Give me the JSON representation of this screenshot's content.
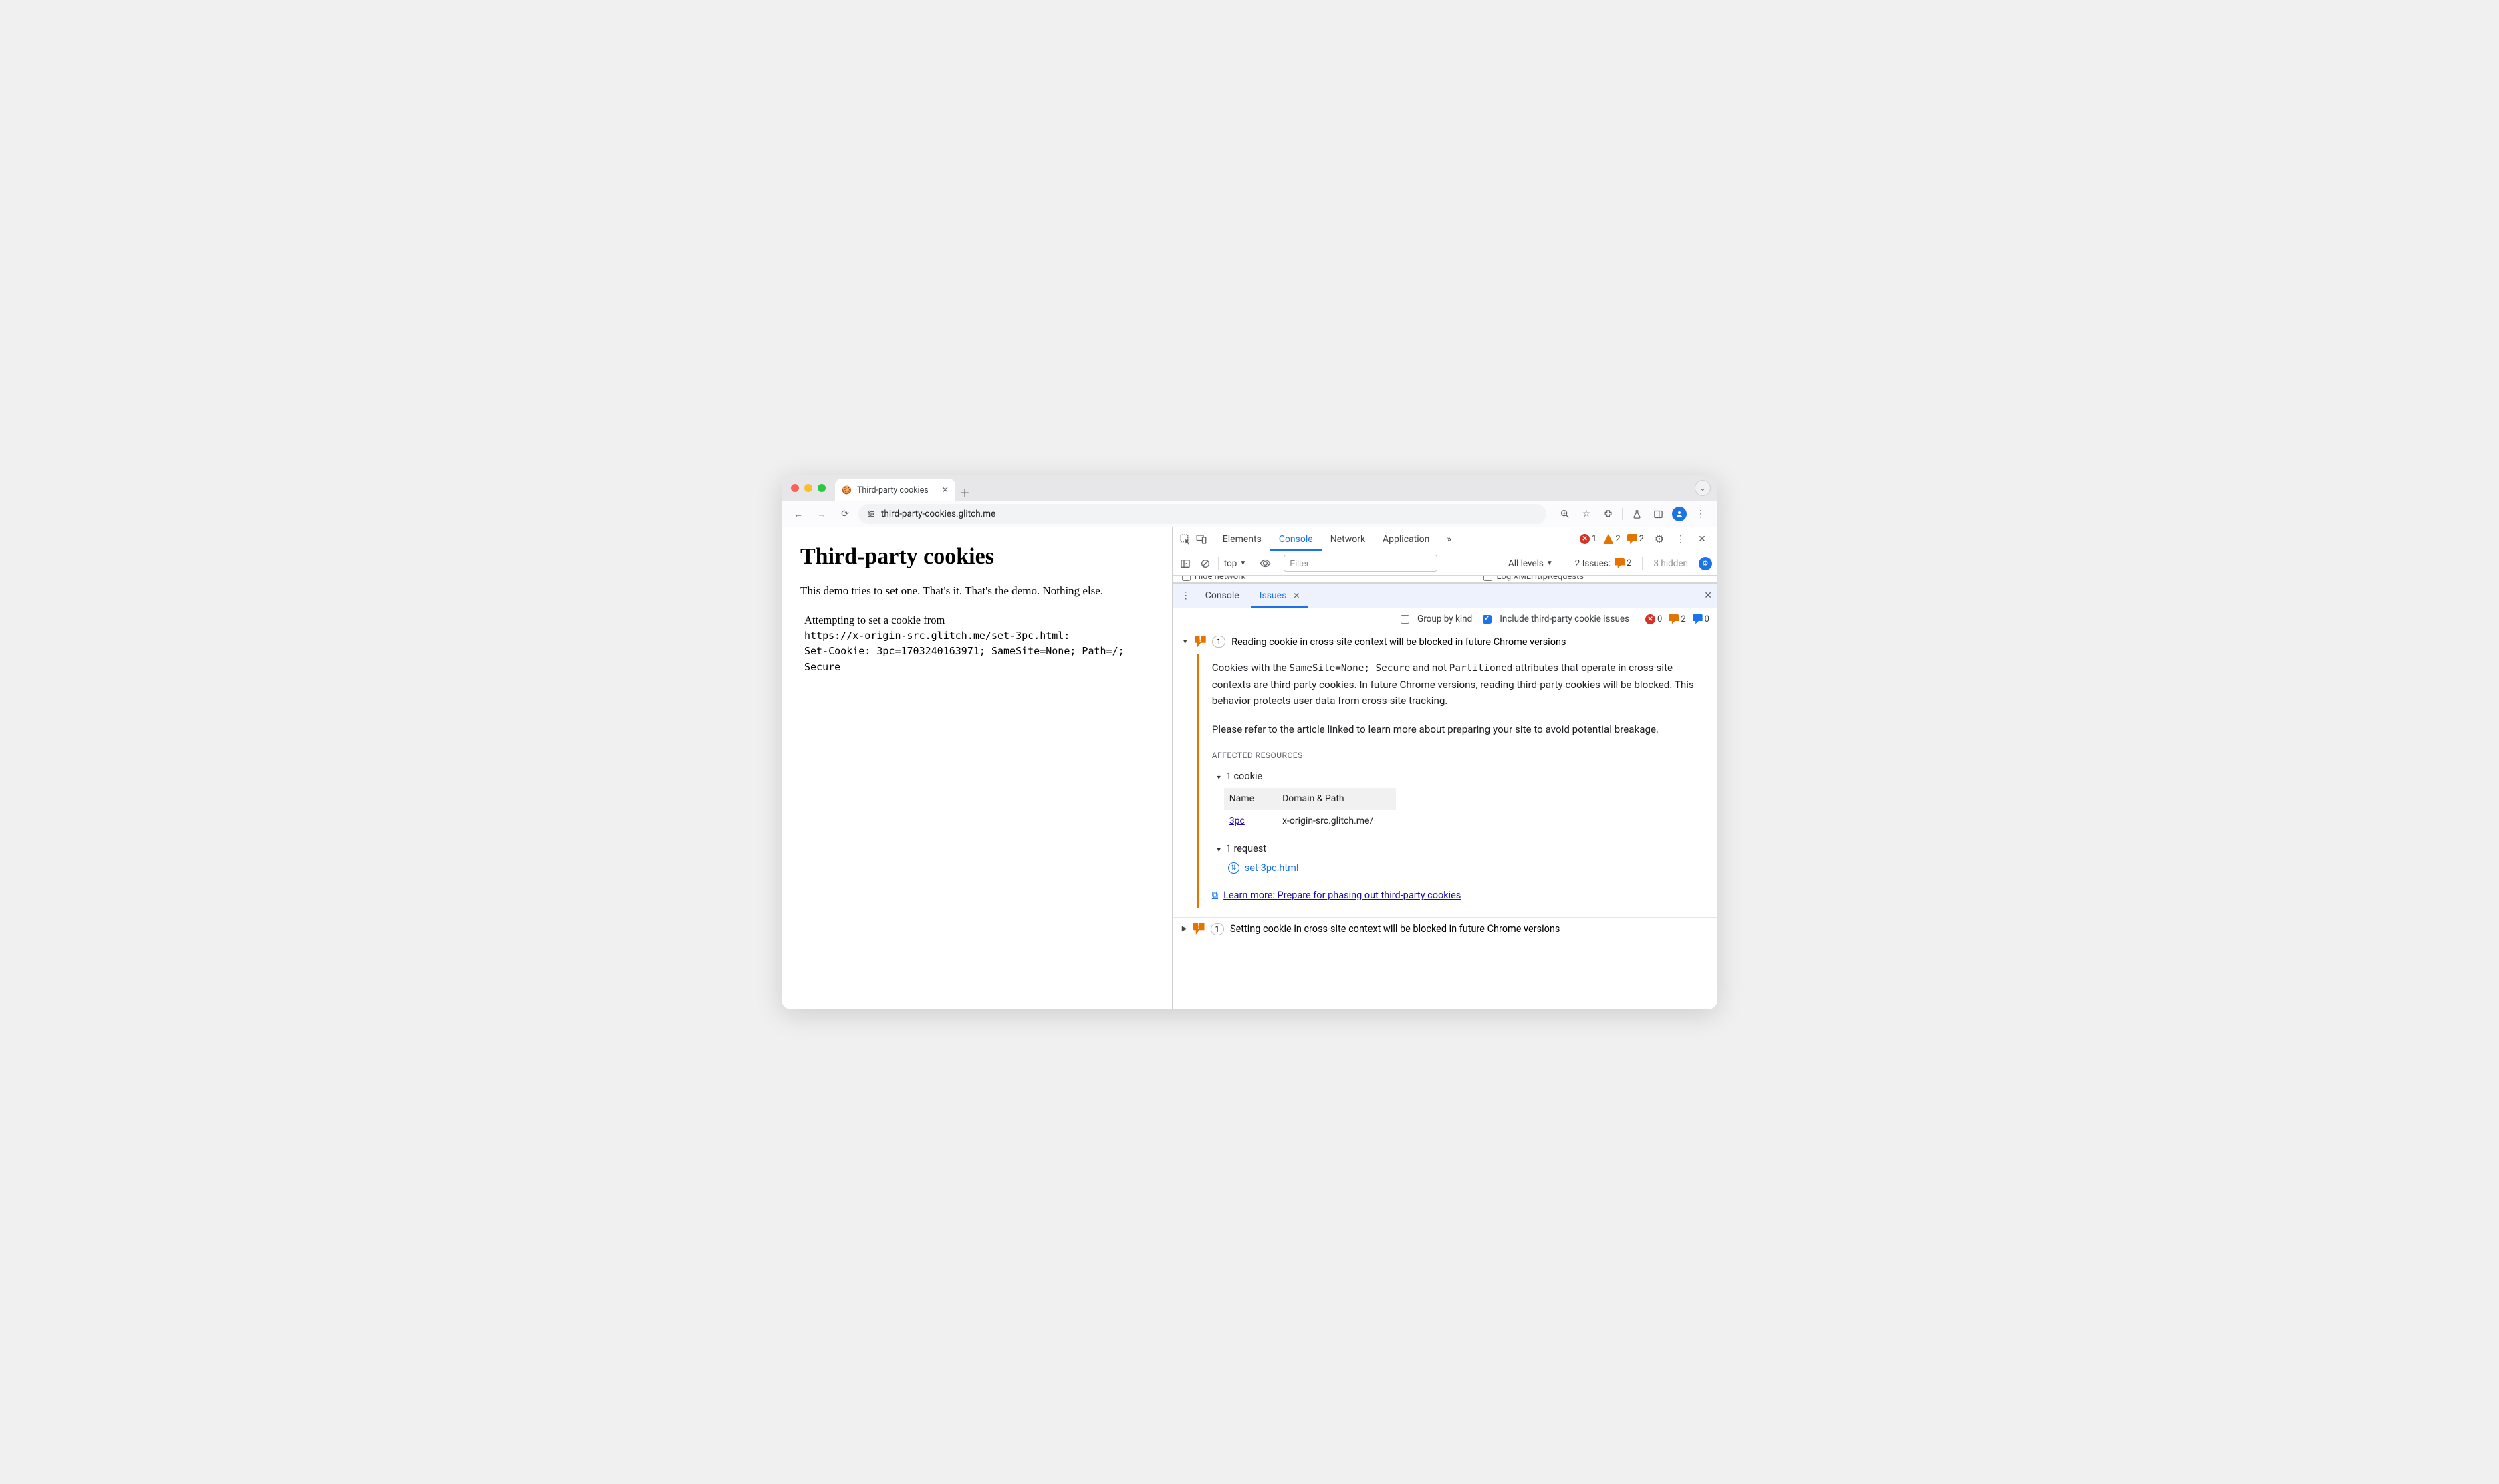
{
  "browser": {
    "tab_title": "Third-party cookies",
    "url": "third-party-cookies.glitch.me"
  },
  "page": {
    "h1": "Third-party cookies",
    "intro": "This demo tries to set one. That's it. That's the demo. Nothing else.",
    "pre_line1": "Attempting to set a cookie from",
    "pre_line2": "https://x-origin-src.glitch.me/set-3pc.html:",
    "pre_line3": "Set-Cookie: 3pc=1703240163971; SameSite=None; Path=/; Secure"
  },
  "devtools": {
    "tabs": {
      "elements": "Elements",
      "console": "Console",
      "network": "Network",
      "application": "Application"
    },
    "counts": {
      "errors": "1",
      "warnings": "2",
      "issues": "2"
    },
    "toolbar": {
      "execution_context": "top",
      "filter_placeholder": "Filter",
      "levels": "All levels",
      "issues_label": "2 Issues:",
      "issues_count": "2",
      "hidden": "3 hidden"
    },
    "drawer": {
      "console": "Console",
      "issues": "Issues",
      "group_by_kind": "Group by kind",
      "include_3pc": "Include third-party cookie issues",
      "c_err": "0",
      "c_warn": "2",
      "c_info": "0"
    },
    "issue1": {
      "count": "1",
      "title": "Reading cookie in cross-site context will be blocked in future Chrome versions",
      "p1a": "Cookies with the ",
      "p1_code1": "SameSite=None; Secure",
      "p1b": " and not ",
      "p1_code2": "Partitioned",
      "p1c": " attributes that operate in cross-site contexts are third-party cookies. In future Chrome versions, reading third-party cookies will be blocked. This behavior protects user data from cross-site tracking.",
      "p2": "Please refer to the article linked to learn more about preparing your site to avoid potential breakage.",
      "affected": "Affected Resources",
      "cookie_node": "1 cookie",
      "th_name": "Name",
      "th_domain": "Domain & Path",
      "td_name": "3pc",
      "td_domain": "x-origin-src.glitch.me/",
      "request_node": "1 request",
      "request_file": "set-3pc.html",
      "learn": "Learn more: Prepare for phasing out third-party cookies"
    },
    "issue2": {
      "count": "1",
      "title": "Setting cookie in cross-site context will be blocked in future Chrome versions"
    }
  }
}
